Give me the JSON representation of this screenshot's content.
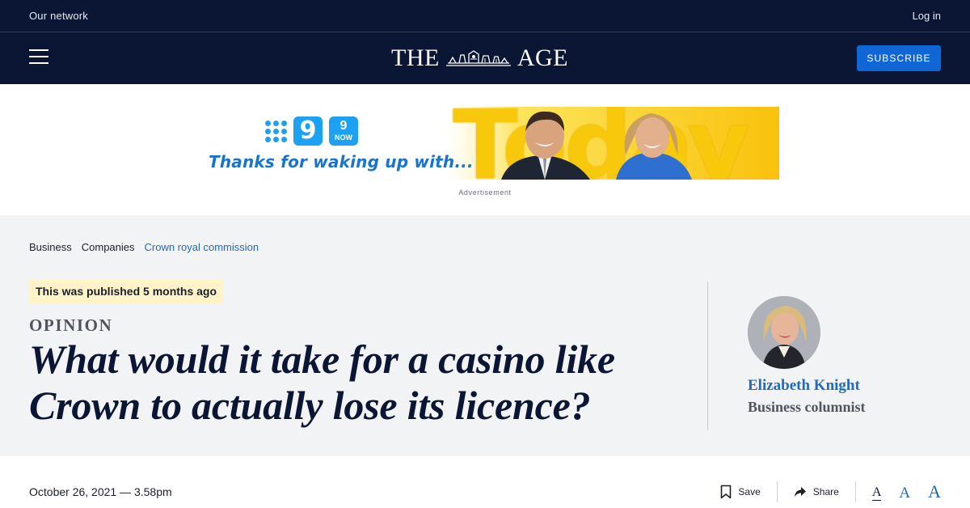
{
  "network_bar": {
    "left_link": "Our network",
    "login": "Log in"
  },
  "masthead": {
    "logo_left": "THE",
    "logo_right": "AGE",
    "subscribe": "SUBSCRIBE"
  },
  "ad": {
    "tagline": "Thanks for waking up with...",
    "logo_text": "9",
    "now_top": "9",
    "now_label": "NOW",
    "show_word": "Today",
    "label": "Advertisement"
  },
  "breadcrumb": [
    "Business",
    "Companies",
    "Crown royal commission"
  ],
  "article": {
    "published_note": "This was published 5 months ago",
    "kicker": "OPINION",
    "headline": "What would it take for a casino like Crown to actually lose its licence?",
    "date": "October 26, 2021 — 3.58pm"
  },
  "author": {
    "name": "Elizabeth Knight",
    "role": "Business columnist"
  },
  "actions": {
    "save": "Save",
    "share": "Share",
    "font_small": "A",
    "font_medium": "A",
    "font_large": "A"
  },
  "icons": {
    "menu": "hamburger-icon",
    "save": "bookmark-icon",
    "share": "share-arrow-icon"
  },
  "colors": {
    "brand_navy": "#0a1633",
    "subscribe_blue": "#0f67d6",
    "link_blue": "#1e6bbf",
    "published_bg": "#fff3c8"
  }
}
